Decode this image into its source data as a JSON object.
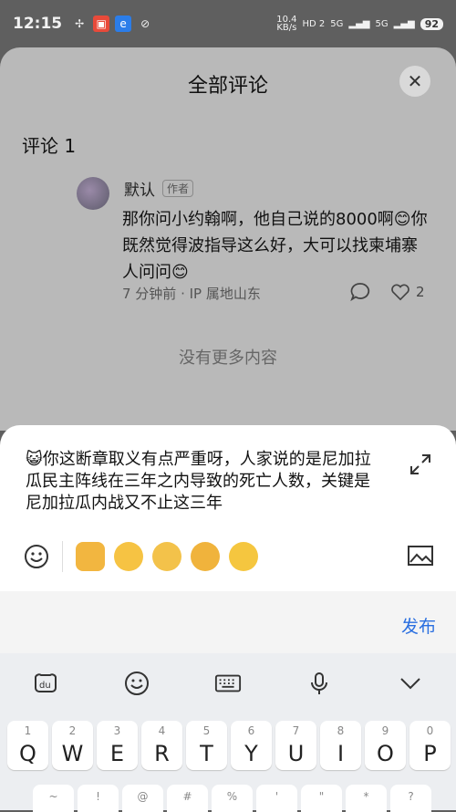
{
  "status_bar": {
    "time": "12:15",
    "speed_top": "10.4",
    "speed_bottom": "KB/s",
    "hd": "HD 2",
    "signal1": "5G",
    "signal2": "5G",
    "battery": "92"
  },
  "sheet": {
    "title": "全部评论",
    "count_label": "评论 1",
    "comment": {
      "author": "默认",
      "author_tag": "作者",
      "text": "那你问小约翰啊，他自己说的8000啊😊你既然觉得波指导这么好，大可以找柬埔寨人问问😊",
      "meta": "7 分钟前 · IP 属地山东",
      "like_count": "2"
    },
    "no_more": "没有更多内容"
  },
  "composer": {
    "text": "😺你这断章取义有点严重呀，人家说的是尼加拉瓜民主阵线在三年之内导致的死亡人数，关键是尼加拉瓜内战又不止这三年",
    "publish_label": "发布"
  },
  "keyboard": {
    "row1": [
      {
        "num": "1",
        "letter": "Q"
      },
      {
        "num": "2",
        "letter": "W"
      },
      {
        "num": "3",
        "letter": "E"
      },
      {
        "num": "4",
        "letter": "R"
      },
      {
        "num": "5",
        "letter": "T"
      },
      {
        "num": "6",
        "letter": "Y"
      },
      {
        "num": "7",
        "letter": "U"
      },
      {
        "num": "8",
        "letter": "I"
      },
      {
        "num": "9",
        "letter": "O"
      },
      {
        "num": "0",
        "letter": "P"
      }
    ],
    "row2_symbols": [
      "~",
      "!",
      "@",
      "#",
      "%",
      "'",
      "\"",
      "*",
      "?"
    ]
  },
  "colors": {
    "accent": "#2a6fe0",
    "overlay": "#b9b9b9"
  }
}
